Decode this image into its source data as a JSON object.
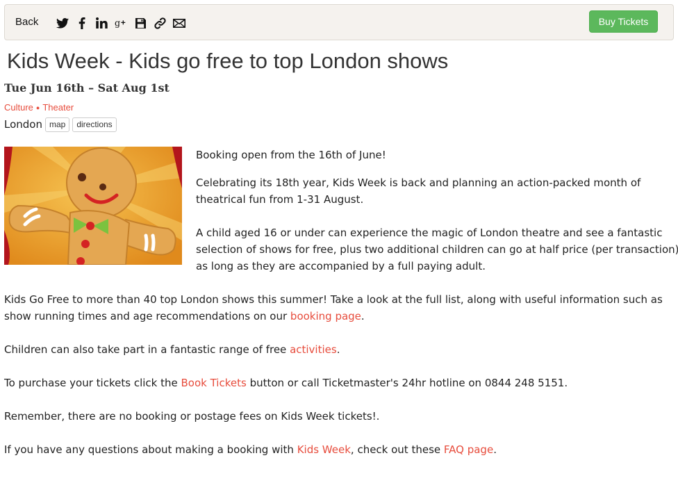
{
  "toolbar": {
    "back_label": "Back",
    "buy_label": "Buy Tickets",
    "buy_color": "#5cb85c",
    "share_icons": [
      "twitter-icon",
      "facebook-icon",
      "linkedin-icon",
      "google-plus-icon",
      "save-icon",
      "link-icon",
      "email-icon"
    ]
  },
  "event": {
    "title": "Kids Week - Kids go free to top London shows",
    "dates": "Tue Jun 16th – Sat Aug 1st",
    "categories": [
      "Culture",
      "Theater"
    ],
    "location": "London",
    "map_label": "map",
    "directions_label": "directions"
  },
  "image": {
    "icon": "gingerbread-man-image",
    "bg_color": "#e9a12a"
  },
  "body": {
    "p1": "Booking open from the 16th of June!",
    "p2_line1": "Celebrating its 18th year, Kids Week is back and planning an action-packed month of",
    "p2_line2": "theatrical fun from 1-31 August.",
    "p3_line1": "A child aged 16 or under can experience the magic of London theatre and see a fantastic",
    "p3_line2": "selection of shows for free, plus two additional children can go at half price (per transaction),",
    "p3_line3": "as long as they are accompanied by a full paying adult.",
    "p4_line1": "Kids Go Free to more than 40 top London shows this summer! Take a look at the full list, along with useful information such as",
    "p4_line2_pre": "show running times and age recommendations on our ",
    "p4_link": "booking page",
    "p4_post": ".",
    "p5_pre": "Children can also take part in a fantastic range of free ",
    "p5_link": "activities",
    "p5_post": ".",
    "p6_pre": "To purchase your tickets click the ",
    "p6_link": "Book Tickets",
    "p6_post": " button or call Ticketmaster's 24hr hotline on 0844 248 5151.",
    "p7": "Remember, there are no booking or postage fees on Kids Week tickets!.",
    "p8_pre": "If you have any questions about making a booking with ",
    "p8_link1": "Kids Week",
    "p8_mid": ", check out these ",
    "p8_link2": "FAQ page",
    "p8_post": "."
  },
  "link_color": "#e74c3c"
}
